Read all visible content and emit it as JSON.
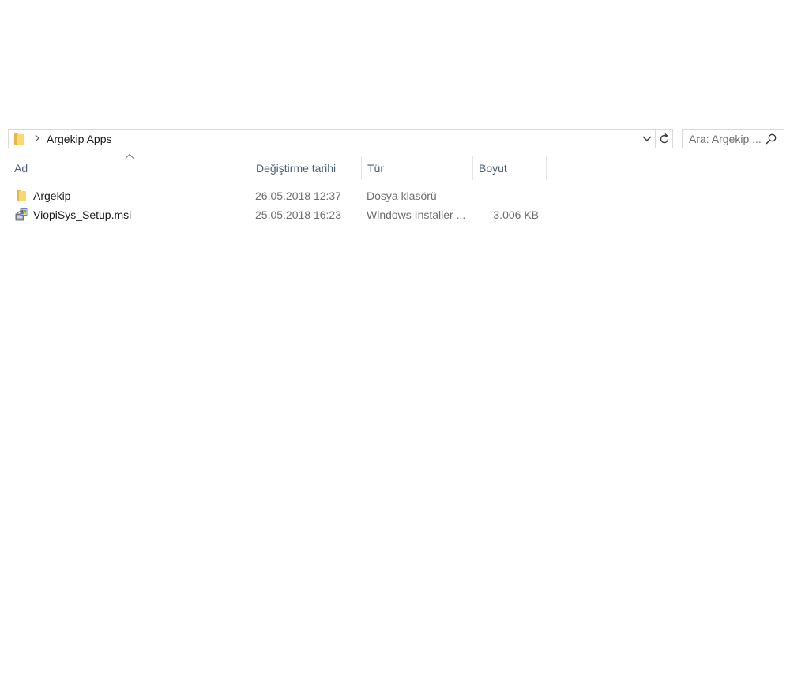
{
  "address_bar": {
    "crumbs": [
      "Argekip Apps"
    ],
    "folder_icon": "folder-icon",
    "separator_icon": "chevron-right-icon",
    "dropdown_icon": "chevron-down-icon"
  },
  "refresh": {
    "icon": "refresh-icon"
  },
  "search": {
    "placeholder": "Ara: Argekip ...",
    "value": "",
    "icon": "search-icon"
  },
  "columns": {
    "name": "Ad",
    "date": "Değiştirme tarihi",
    "type": "Tür",
    "size": "Boyut",
    "sort_icon": "sort-ascending-caret-icon"
  },
  "files": [
    {
      "name": "Argekip",
      "date": "26.05.2018 12:37",
      "type": "Dosya klasörü",
      "size": "",
      "icon": "folder-icon"
    },
    {
      "name": "ViopiSys_Setup.msi",
      "date": "25.05.2018 16:23",
      "type": "Windows Installer ...",
      "size": "3.006 KB",
      "icon": "windows-installer-icon"
    }
  ],
  "colors": {
    "folder_yellow": "#f8d775",
    "folder_dark": "#e6b743",
    "header_text": "#4c607a",
    "secondary_text": "#6d6d6d",
    "border": "#d9d9d9"
  }
}
